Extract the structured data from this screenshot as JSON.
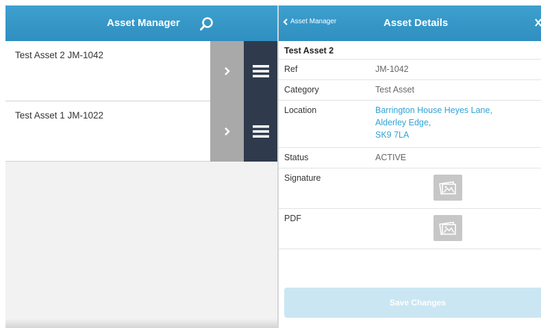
{
  "list_panel": {
    "title": "Asset Manager",
    "assets": [
      {
        "label": "Test Asset 2 JM-1042"
      },
      {
        "label": "Test Asset 1 JM-1022"
      }
    ]
  },
  "detail_panel": {
    "back_label": "Asset Manager",
    "title": "Asset Details",
    "asset_name": "Test Asset 2",
    "fields": {
      "ref": {
        "label": "Ref",
        "value": "JM-1042"
      },
      "category": {
        "label": "Category",
        "value": "Test Asset"
      },
      "location": {
        "label": "Location",
        "lines": [
          "Barrington House Heyes Lane,",
          "Alderley Edge,",
          "SK9 7LA"
        ]
      },
      "status": {
        "label": "Status",
        "value": "ACTIVE"
      },
      "signature": {
        "label": "Signature",
        "icon": "image-placeholder-icon"
      },
      "pdf": {
        "label": "PDF",
        "icon": "image-placeholder-icon"
      }
    },
    "save_label": "Save Changes"
  },
  "icons": {
    "search": "search-icon",
    "chevron": "chevron-right-icon",
    "menu": "hamburger-menu-icon",
    "back": "chevron-left-icon",
    "close": "close-icon"
  },
  "colors": {
    "header": "#3399cc",
    "menu_button": "#2f3b4c",
    "chevron_button": "#a9a9a9",
    "link": "#2fa3d6",
    "save_disabled": "#cbe6f3"
  }
}
